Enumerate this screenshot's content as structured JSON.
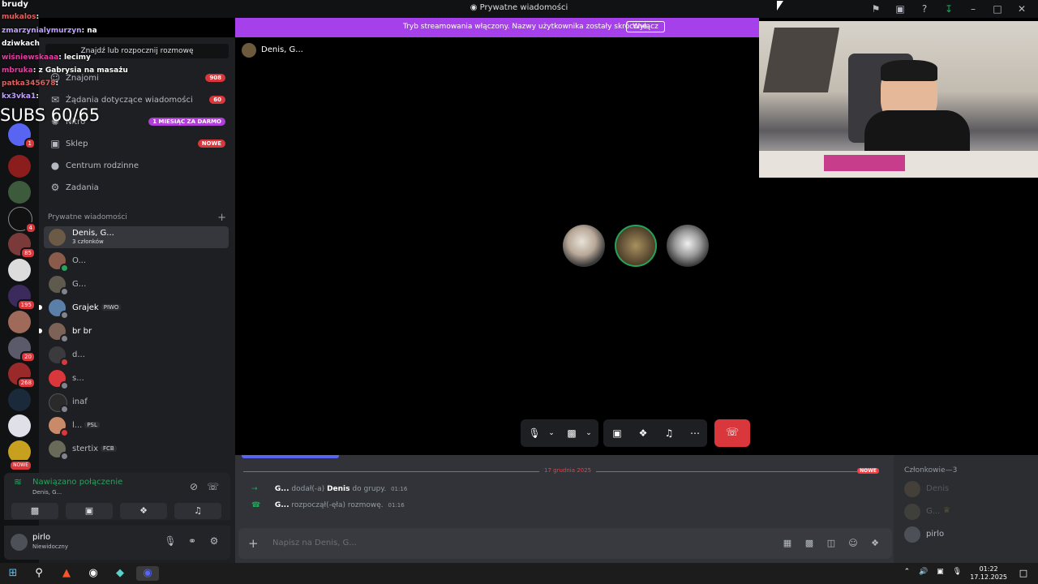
{
  "window": {
    "title": "Prywatne wiadomości",
    "title_icon": "discord-icon",
    "icons": [
      "flag-icon",
      "screen-share-icon",
      "help-icon",
      "download-icon",
      "minimize-icon",
      "maximize-icon",
      "close-icon"
    ]
  },
  "banner": {
    "text": "Tryb streamowania włączony. Nazwy użytkownika zostały skrócone.",
    "button": "Wyłącz",
    "color": "#a640ea"
  },
  "overlay_chat": {
    "header": "brudy",
    "lines": [
      {
        "user": "mukalos",
        "text": ":"
      },
      {
        "user": "zmarzynialymurzyn",
        "text": ": na"
      },
      {
        "user": "",
        "text": "dziwkach"
      },
      {
        "user": "wiśniewskaaa",
        "text": ": lecimy"
      },
      {
        "user": "mbruka",
        "text": ": z Gabrysia na masażu"
      },
      {
        "user": "patka345678",
        "text": ":"
      },
      {
        "user": "kx3vka1",
        "text": ":"
      }
    ],
    "subs": "SUBS 60/65"
  },
  "server_rail": {
    "badges": [
      "1",
      "",
      "",
      "4",
      "85",
      "",
      "195",
      "20",
      "268",
      "",
      "",
      "NOWE"
    ]
  },
  "sidebar": {
    "search_placeholder": "Znajdź lub rozpocznij rozmowę",
    "nav": [
      {
        "label": "Znajomi",
        "icon": "friends-icon",
        "pill": "908"
      },
      {
        "label": "Żądania dotyczące wiadomości",
        "icon": "mail-icon",
        "pill": "60"
      },
      {
        "label": "Nitro",
        "icon": "nitro-icon",
        "pill": "1 MIESIĄC ZA DARMO"
      },
      {
        "label": "Sklep",
        "icon": "shop-icon",
        "pill": "NOWE"
      },
      {
        "label": "Centrum rodzinne",
        "icon": "family-icon",
        "pill": ""
      },
      {
        "label": "Zadania",
        "icon": "quests-icon",
        "pill": ""
      }
    ],
    "dm_header": "Prywatne wiadomości",
    "dms": [
      {
        "name": "Denis, G...",
        "sub": "3 członków",
        "tag": "",
        "color": "#6b5a45"
      },
      {
        "name": "O...",
        "sub": "",
        "tag": "",
        "color": "#8a5b4a"
      },
      {
        "name": "G...",
        "sub": "",
        "tag": "",
        "color": "#5e5a4e"
      },
      {
        "name": "Grajek",
        "sub": "",
        "tag": "PIWO",
        "color": "#5a7fa8"
      },
      {
        "name": "br br",
        "sub": "",
        "tag": "",
        "color": "#7d6258"
      },
      {
        "name": "d...",
        "sub": "",
        "tag": "",
        "color": "#3b3b3d"
      },
      {
        "name": "s...",
        "sub": "",
        "tag": "",
        "color": "#da373c"
      },
      {
        "name": "inaf",
        "sub": "",
        "tag": "",
        "color": "#2a2a2a"
      },
      {
        "name": "l...",
        "sub": "",
        "tag": "PSL",
        "color": "#c98a6a"
      },
      {
        "name": "stertix",
        "sub": "",
        "tag": "FCB",
        "color": "#6a6a5a"
      }
    ]
  },
  "voice": {
    "status": "Nawiązano połączenie",
    "channel": "Denis, G..."
  },
  "user": {
    "name": "pirlo",
    "status": "Niewidoczny"
  },
  "call": {
    "name": "Denis, G...",
    "participants": 3
  },
  "chat": {
    "date": "17 grudnia 2025",
    "new_label": "NOWE",
    "messages": [
      {
        "who": "G...",
        "action": "dodał(-a)",
        "target": "Denis",
        "rest": "do grupy.",
        "time": "01:16"
      },
      {
        "who": "G...",
        "action": "rozpoczął(-ęła) rozmowę.",
        "target": "",
        "rest": "",
        "time": "01:16"
      }
    ],
    "composer_placeholder": "Napisz na Denis, G..."
  },
  "members": {
    "header": "Członkowie—3",
    "list": [
      "Denis",
      "G...",
      "pirlo"
    ]
  },
  "taskbar": {
    "time": "01:22",
    "date": "17.12.2025"
  }
}
